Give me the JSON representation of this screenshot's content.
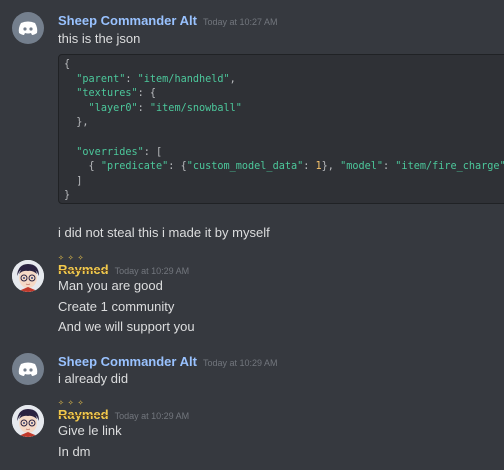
{
  "messages": [
    {
      "author": "Sheep Commander Alt",
      "timestamp": "Today at 10:27 AM",
      "lines": [
        "this is the json"
      ],
      "code": {
        "l1": "{",
        "l2_key": "\"parent\"",
        "l2_val": "\"item/handheld\"",
        "l3_key": "\"textures\"",
        "l4_key": "\"layer0\"",
        "l4_val": "\"item/snowball\"",
        "l5": "},",
        "l7_key": "\"overrides\"",
        "l8_k1": "\"predicate\"",
        "l8_k2": "\"custom_model_data\"",
        "l8_n": "1",
        "l8_k3": "\"model\"",
        "l8_v": "\"item/fire_charge\"",
        "l9": "]",
        "l10": "}"
      },
      "after": "i did not steal this i made it by myself"
    },
    {
      "author": "Raymed",
      "timestamp": "Today at 10:29 AM",
      "lines": [
        "Man you are good",
        "Create 1 community",
        "And we will support you"
      ]
    },
    {
      "author": "Sheep Commander Alt",
      "timestamp": "Today at 10:29 AM",
      "lines": [
        "i already did"
      ]
    },
    {
      "author": "Raymed",
      "timestamp": "Today at 10:29 AM",
      "lines": [
        "Give le link",
        "In dm"
      ]
    }
  ],
  "icons": {
    "discord": "discord-logo-icon",
    "anime": "user-avatar-image"
  },
  "colors": {
    "background": "#36393f",
    "code_bg": "#2f3136",
    "bot_name": "#99c2ff",
    "user_name": "#f2c94c",
    "code_key": "#4cc79b",
    "code_number": "#f7c26b"
  }
}
